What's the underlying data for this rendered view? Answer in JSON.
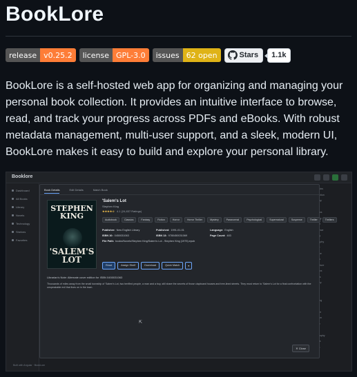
{
  "page": {
    "title": "BookLore",
    "description": "BookLore is a self-hosted web app for organizing and managing your personal book collection. It provides an intuitive interface to browse, read, and track your progress across PDFs and eBooks. With robust metadata management, multi-user support, and a sleek, modern UI, BookLore makes it easy to build and explore your personal library."
  },
  "badges": [
    {
      "label": "release",
      "value": "v0.25.2",
      "color": "#fe7d37"
    },
    {
      "label": "license",
      "value": "GPL-3.0",
      "color": "#fe7d37"
    },
    {
      "label": "issues",
      "value": "62 open",
      "color": "#dfb317"
    }
  ],
  "github": {
    "stars_label": "Stars",
    "stars_count": "1.1k",
    "icon": "github-icon"
  },
  "screenshot": {
    "logo": "Booklore",
    "sidebar": [
      "Dashboard",
      "All Books",
      "Library",
      "Novels",
      "Technology",
      "Shelves",
      "Favorites"
    ],
    "right_list": [
      "All Books",
      "Sci-Fiction",
      "Fantasy",
      "Horror",
      "Classics",
      "Mystery",
      "Thriller",
      "Romance",
      "History",
      "Biography",
      "Poetry",
      "Science",
      "Drama",
      "Adventure",
      "Classics",
      "Essays",
      "Mystery",
      "Horror",
      "Travel",
      "Cooking",
      "Art",
      "Memoir",
      "Religion",
      "Nature",
      "Music",
      "Philosophy",
      "Politics",
      "Health"
    ],
    "modal": {
      "tabs": [
        "Book Details",
        "Edit Details",
        "Match Book"
      ],
      "cover_author": "STEPHEN KING",
      "cover_title": "'SALEM'S LOT",
      "book_title": "'Salem's Lot",
      "author": "Stephen King",
      "rating": "★★★★☆",
      "rating_count": "4.1 (24,837 Ratings)",
      "tags": [
        "Audiobook",
        "Classics",
        "Fantasy",
        "Fiction",
        "Horror",
        "Horror Thriller",
        "Mystery",
        "Paranormal",
        "Psychological",
        "Supernatural",
        "Suspense",
        "Thriller",
        "Thrillers"
      ],
      "meta": [
        {
          "k": "Publisher:",
          "v": "New English Library"
        },
        {
          "k": "Published:",
          "v": "1991-01-01"
        },
        {
          "k": "Language:",
          "v": "English"
        },
        {
          "k": "ISBN 10:",
          "v": "0450031063"
        },
        {
          "k": "ISBN 13:",
          "v": "9780450031069"
        },
        {
          "k": "Page Count:",
          "v": "483"
        },
        {
          "k": "File Path:",
          "v": "books/Novels/Stephen King/Salem's Lot - Stephen King (1975).epub"
        }
      ],
      "actions": [
        "Read",
        "Assign Shelf",
        "Download",
        "Quick Match"
      ],
      "desc_label": "Librarian's Note: Alternate cover edition for ISBN 0450031063",
      "desc_text": "Thousands of miles away from the small township of 'Salem's Lot, two terrified people, a man and a boy, still share the secrets of those clapboard houses and tree-lined streets. They must return to 'Salem's Lot for a final confrontation with the unspeakable evil that lives on in the town.",
      "close": "Close"
    },
    "footer": "Built with Angular · BookLore"
  }
}
